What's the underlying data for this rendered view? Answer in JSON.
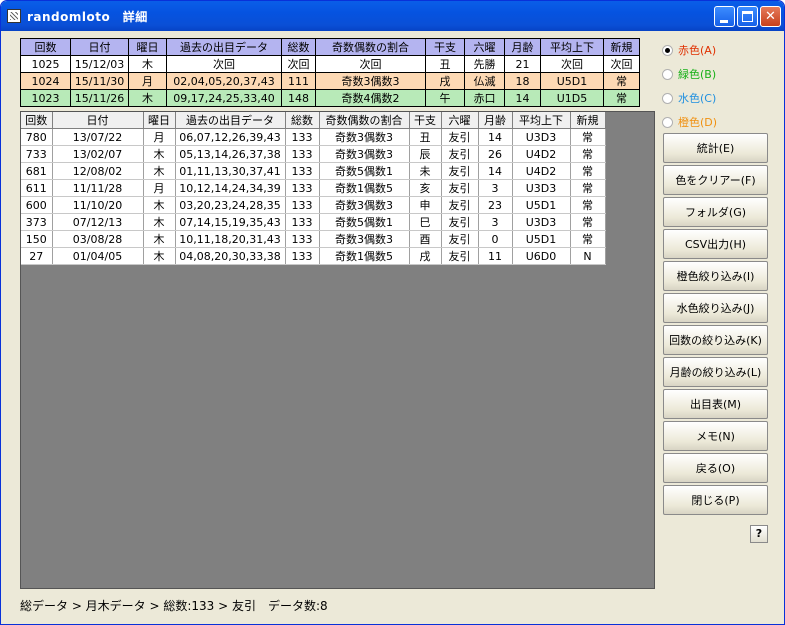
{
  "window": {
    "title": "randomloto　詳細",
    "min": "_",
    "max": "□",
    "close": "✕"
  },
  "top_table": {
    "headers": [
      "回数",
      "日付",
      "曜日",
      "過去の出目データ",
      "総数",
      "奇数偶数の割合",
      "干支",
      "六曜",
      "月齢",
      "平均上下",
      "新規"
    ],
    "rows": [
      [
        "1025",
        "15/12/03",
        "木",
        "次回",
        "次回",
        "次回",
        "丑",
        "先勝",
        "21",
        "次回",
        "次回"
      ],
      [
        "1024",
        "15/11/30",
        "月",
        "02,04,05,20,37,43",
        "111",
        "奇数3偶数3",
        "戌",
        "仏滅",
        "18",
        "U5D1",
        "常"
      ],
      [
        "1023",
        "15/11/26",
        "木",
        "09,17,24,25,33,40",
        "148",
        "奇数4偶数2",
        "午",
        "赤口",
        "14",
        "U1D5",
        "常"
      ]
    ]
  },
  "main_table": {
    "headers": [
      "回数",
      "日付",
      "曜日",
      "過去の出目データ",
      "総数",
      "奇数偶数の割合",
      "干支",
      "六曜",
      "月齢",
      "平均上下",
      "新規"
    ],
    "rows": [
      [
        "780",
        "13/07/22",
        "月",
        "06,07,12,26,39,43",
        "133",
        "奇数3偶数3",
        "丑",
        "友引",
        "14",
        "U3D3",
        "常"
      ],
      [
        "733",
        "13/02/07",
        "木",
        "05,13,14,26,37,38",
        "133",
        "奇数3偶数3",
        "辰",
        "友引",
        "26",
        "U4D2",
        "常"
      ],
      [
        "681",
        "12/08/02",
        "木",
        "01,11,13,30,37,41",
        "133",
        "奇数5偶数1",
        "未",
        "友引",
        "14",
        "U4D2",
        "常"
      ],
      [
        "611",
        "11/11/28",
        "月",
        "10,12,14,24,34,39",
        "133",
        "奇数1偶数5",
        "亥",
        "友引",
        "3",
        "U3D3",
        "常"
      ],
      [
        "600",
        "11/10/20",
        "木",
        "03,20,23,24,28,35",
        "133",
        "奇数3偶数3",
        "申",
        "友引",
        "23",
        "U5D1",
        "常"
      ],
      [
        "373",
        "07/12/13",
        "木",
        "07,14,15,19,35,43",
        "133",
        "奇数5偶数1",
        "巳",
        "友引",
        "3",
        "U3D3",
        "常"
      ],
      [
        "150",
        "03/08/28",
        "木",
        "10,11,18,20,31,43",
        "133",
        "奇数3偶数3",
        "酉",
        "友引",
        "0",
        "U5D1",
        "常"
      ],
      [
        "27",
        "01/04/05",
        "木",
        "04,08,20,30,33,38",
        "133",
        "奇数1偶数5",
        "戌",
        "友引",
        "11",
        "U6D0",
        "N"
      ]
    ]
  },
  "radios": [
    {
      "label": "赤色(A)",
      "color": "#e03000",
      "checked": true
    },
    {
      "label": "緑色(B)",
      "color": "#18b018",
      "checked": false
    },
    {
      "label": "水色(C)",
      "color": "#2090e0",
      "checked": false
    },
    {
      "label": "橙色(D)",
      "color": "#f09010",
      "checked": false
    }
  ],
  "buttons": [
    "統計(E)",
    "色をクリアー(F)",
    "フォルダ(G)",
    "CSV出力(H)",
    "橙色絞り込み(I)",
    "水色絞り込み(J)",
    "回数の絞り込み(K)",
    "月齢の絞り込み(L)",
    "出目表(M)",
    "メモ(N)",
    "戻る(O)",
    "閉じる(P)"
  ],
  "help": "?",
  "status": "総データ > 月木データ > 総数:133 > 友引　データ数:8"
}
